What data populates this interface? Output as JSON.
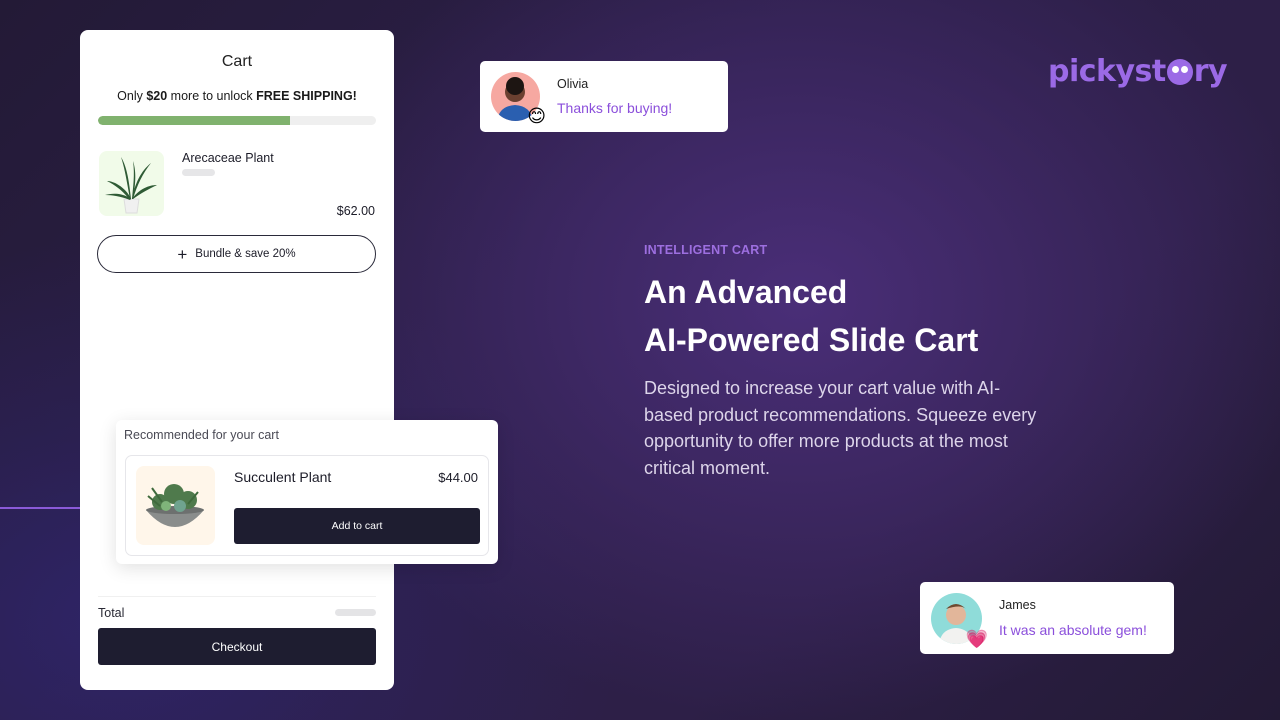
{
  "cart": {
    "title": "Cart",
    "shipping_prefix": "Only ",
    "shipping_amount": "$20",
    "shipping_middle": " more to unlock ",
    "shipping_goal": "FREE SHIPPING!",
    "shipping_progress_percent": 69,
    "progress_color": "#80b26e",
    "item": {
      "name": "Arecaceae Plant",
      "price": "$62.00",
      "thumb_icon": "potted-palm-plant-image"
    },
    "bundle_button": {
      "icon": "plus-icon",
      "label": "Bundle & save 20%"
    },
    "total_label": "Total",
    "checkout_label": "Checkout"
  },
  "recommendation": {
    "title": "Recommended for your cart",
    "product": {
      "name": "Succulent Plant",
      "price": "$44.00",
      "thumb_icon": "succulent-bowl-image"
    },
    "add_button_label": "Add to cart"
  },
  "bubbles": [
    {
      "name": "Olivia",
      "message": "Thanks for buying!",
      "emoji": "😊",
      "avatar_color": "#f6a8a1"
    },
    {
      "name": "James",
      "message": "It was an absolute gem!",
      "emoji": "💗",
      "avatar_color": "#8fdcd9"
    }
  ],
  "brand": {
    "logo_text_a": "pickyst",
    "logo_text_b": "ry",
    "accent": "#9b6ae6"
  },
  "hero": {
    "eyebrow": "INTELLIGENT CART",
    "headline_line1": "An Advanced",
    "headline_line2": "AI-Powered Slide Cart",
    "description": "Designed to increase your cart value with AI-based product recommendations. Squeeze every opportunity to offer more products at the most critical moment."
  }
}
